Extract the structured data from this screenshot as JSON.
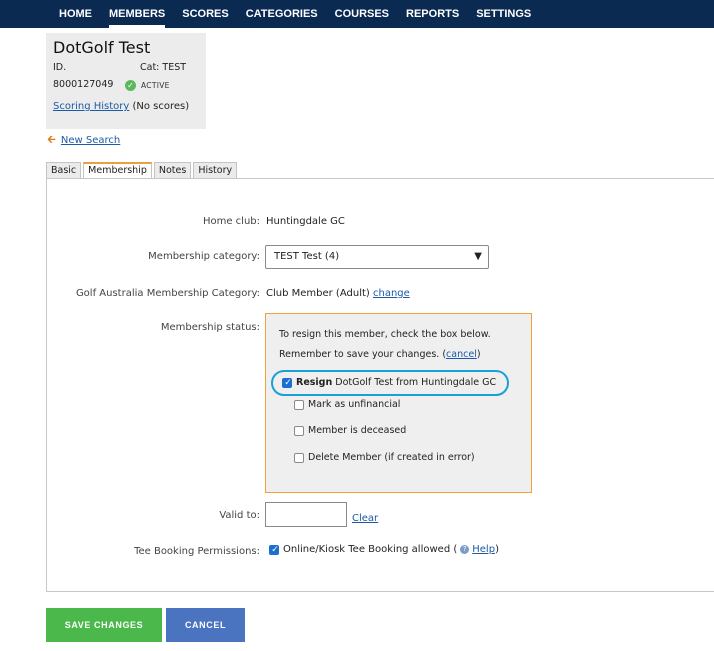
{
  "nav": {
    "items": [
      "HOME",
      "MEMBERS",
      "SCORES",
      "CATEGORIES",
      "COURSES",
      "REPORTS",
      "SETTINGS"
    ],
    "active": "MEMBERS"
  },
  "member": {
    "name": "DotGolf Test",
    "id_label": "ID.",
    "id_value": "8000127049",
    "cat_label": "Cat: TEST",
    "status_badge": "ACTIVE",
    "scoring_history_link": "Scoring History",
    "scoring_history_note": "(No scores)"
  },
  "new_search_link": "New Search",
  "tabs": [
    "Basic",
    "Membership",
    "Notes",
    "History"
  ],
  "form": {
    "home_club_label": "Home club:",
    "home_club_value": "Huntingdale GC",
    "category_label": "Membership category:",
    "category_selected": "TEST Test (4)",
    "ga_category_label": "Golf Australia Membership Category:",
    "ga_category_value": "Club Member (Adult)",
    "ga_change_link": "change",
    "status_label": "Membership status:",
    "status": {
      "instruction": "To resign this member, check the box below.",
      "remember_prefix": "Remember to save your changes. (",
      "cancel_link": "cancel",
      "remember_suffix": ")",
      "resign_bold": "Resign",
      "resign_rest": "DotGolf Test from Huntingdale GC",
      "unfinancial": "Mark as unfinancial",
      "deceased": "Member is deceased",
      "delete": "Delete Member (if created in error)"
    },
    "valid_to_label": "Valid to:",
    "clear_link": "Clear",
    "tee_label": "Tee Booking Permissions:",
    "tee_value": "Online/Kiosk Tee Booking allowed (",
    "help_link": "Help",
    "tee_close": ")"
  },
  "buttons": {
    "save": "SAVE CHANGES",
    "cancel": "CANCEL"
  },
  "colors": {
    "nav_bg": "#0a2a52",
    "save_bg": "#4ab84a",
    "cancel_bg": "#4a73c0",
    "status_border": "#f2a134",
    "highlight": "#1aa0d8"
  }
}
